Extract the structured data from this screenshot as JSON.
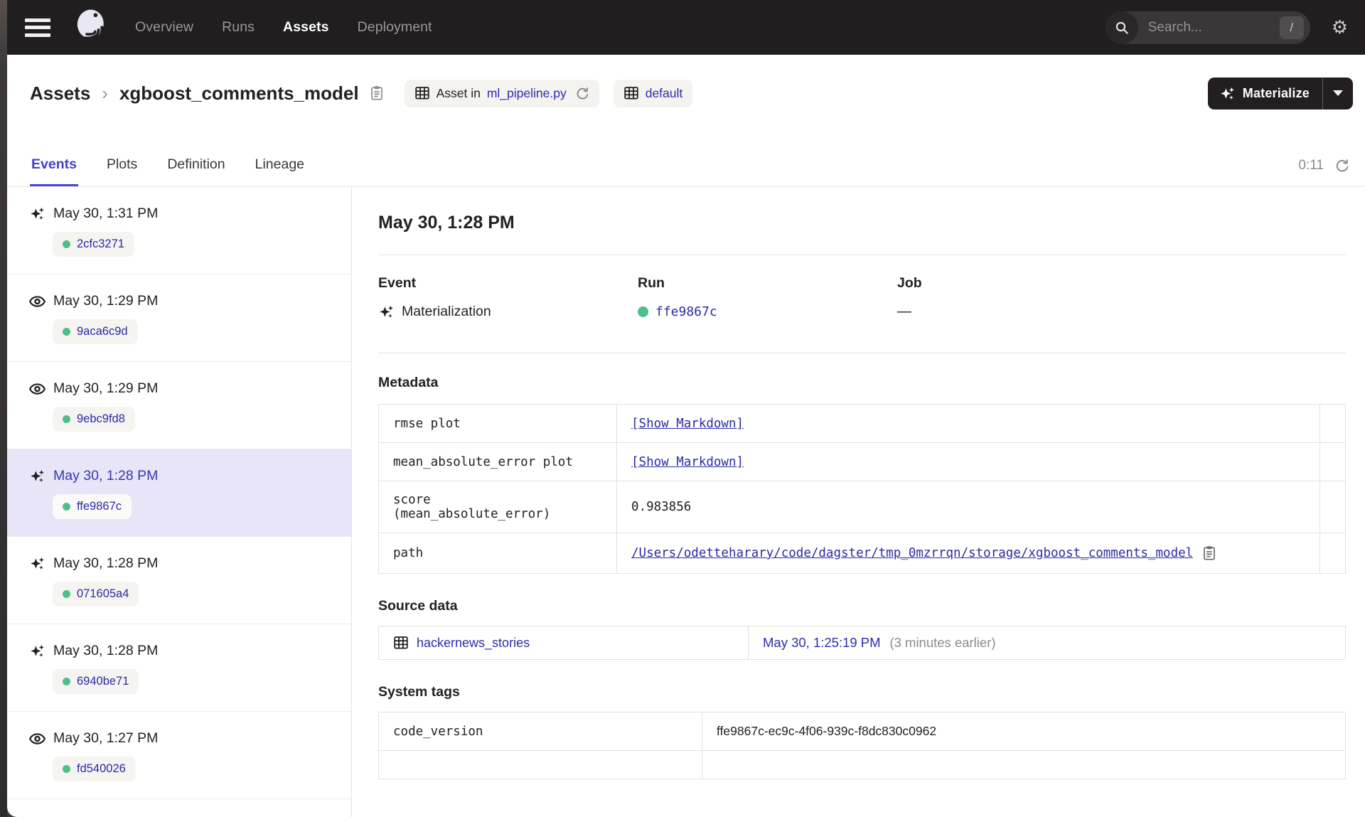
{
  "topnav": {
    "items": [
      {
        "label": "Overview"
      },
      {
        "label": "Runs"
      },
      {
        "label": "Assets"
      },
      {
        "label": "Deployment"
      }
    ],
    "search": {
      "placeholder": "Search...",
      "shortcut": "/"
    }
  },
  "header": {
    "breadcrumb_root": "Assets",
    "breadcrumb_separator": "›",
    "title": "xgboost_comments_model",
    "asset_badge": {
      "prefix": "Asset in",
      "link": "ml_pipeline.py"
    },
    "repo_badge": {
      "label": "default"
    },
    "materialize_label": "Materialize"
  },
  "tabs": {
    "items": [
      {
        "label": "Events"
      },
      {
        "label": "Plots"
      },
      {
        "label": "Definition"
      },
      {
        "label": "Lineage"
      }
    ],
    "refresh_timer": "0:11"
  },
  "sidebar": {
    "events": [
      {
        "type": "materialization",
        "time": "May 30, 1:31 PM",
        "run_id": "2cfc3271"
      },
      {
        "type": "observation",
        "time": "May 30, 1:29 PM",
        "run_id": "9aca6c9d"
      },
      {
        "type": "observation",
        "time": "May 30, 1:29 PM",
        "run_id": "9ebc9fd8"
      },
      {
        "type": "materialization",
        "time": "May 30, 1:28 PM",
        "run_id": "ffe9867c"
      },
      {
        "type": "materialization",
        "time": "May 30, 1:28 PM",
        "run_id": "071605a4"
      },
      {
        "type": "materialization",
        "time": "May 30, 1:28 PM",
        "run_id": "6940be71"
      },
      {
        "type": "observation",
        "time": "May 30, 1:27 PM",
        "run_id": "fd540026"
      }
    ]
  },
  "detail": {
    "title": "May 30, 1:28 PM",
    "event_label": "Event",
    "event_value": "Materialization",
    "run_label": "Run",
    "run_value": "ffe9867c",
    "job_label": "Job",
    "job_value": "—",
    "metadata": {
      "title": "Metadata",
      "rows": [
        {
          "key": "rmse plot",
          "value": "[Show Markdown]"
        },
        {
          "key": "mean_absolute_error plot",
          "value": "[Show Markdown]"
        },
        {
          "key": "score\n(mean_absolute_error)",
          "value": "0.983856"
        },
        {
          "key": "path",
          "value": "/Users/odetteharary/code/dagster/tmp_0mzrrqn/storage/xgboost_comments_model"
        }
      ]
    },
    "source_data": {
      "title": "Source data",
      "asset": "hackernews_stories",
      "timestamp": "May 30, 1:25:19 PM",
      "relative": "(3 minutes earlier)"
    },
    "system_tags": {
      "title": "System tags",
      "rows": [
        {
          "key": "code_version",
          "value": "ffe9867c-ec9c-4f06-939c-f8dc830c0962"
        }
      ]
    }
  },
  "colors": {
    "topbar_bg": "#211e20",
    "accent_tab": "#4340cc",
    "link_blue": "#2b2aa5",
    "success_green": "#4ebe8b",
    "selected_row_bg": "#e7e5f7"
  }
}
